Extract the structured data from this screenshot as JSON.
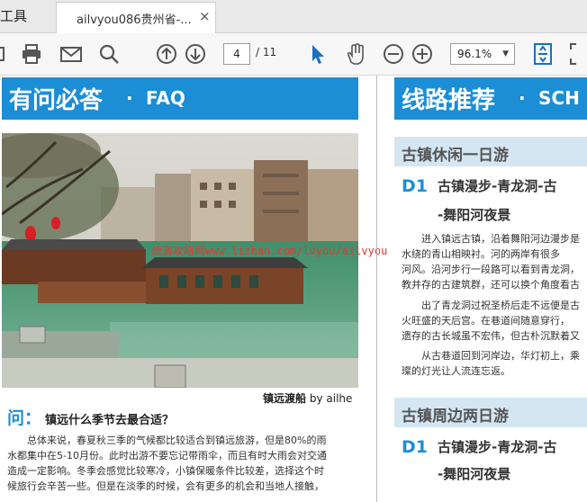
{
  "tabs": {
    "tools_label": "工具",
    "doc_label": "ailvyou086贵州省-...",
    "close_symbol": "×"
  },
  "toolbar": {
    "page_current": "4",
    "page_total": "/ 11",
    "zoom": "96.1%"
  },
  "left": {
    "banner_main": "有问必答",
    "banner_dot": "·",
    "banner_en": "FAQ",
    "watermark": "旅游攻略网www.lizhan.com/lvyou/ailvyou",
    "caption_title": "镇远渡船",
    "caption_by": "by ailhe",
    "q_mark": "问：",
    "question": "镇远什么季节去最合适？",
    "answer_lines": [
      "总体来说，春夏秋三季的气候都比较适合到镇远旅游，但是80%的雨",
      "水都集中在5-10月份。此时出游不要忘记带雨伞，而且有时大雨会对交通",
      "造成一定影响。冬季会感觉比较寒冷，小镇保暖条件比较差，选择这个时",
      "候旅行会辛苦一些。但是在淡季的时候，会有更多的机会和当地人接触，"
    ]
  },
  "right": {
    "banner_main": "线路推荐",
    "banner_dot": "·",
    "banner_en": "SCH",
    "sec1": "古镇休闲一日游",
    "d1_label": "D1",
    "d1_title_1": "古镇漫步-青龙洞-古",
    "d1_title_2": "-舞阳河夜景",
    "d1_lines": [
      "进入镇远古镇，沿着舞阳河边漫步是",
      "水绕的青山相映衬。河的两岸有很多",
      "河风。沿河步行一段路可以看到青龙洞，",
      "教并存的古建筑群，还可以换个角度看古",
      "出了青龙洞过祝圣桥后走不远便是古",
      "火旺盛的天后宫。在巷道间随意穿行，",
      "遗存的古长城虽不宏伟，但古朴沉默着又",
      "从古巷道回到河岸边，华灯初上，乘",
      "璨的灯光让人流连忘返。"
    ],
    "sec2": "古镇周边两日游",
    "d1b_label": "D1",
    "d1b_title_1": "古镇漫步-青龙洞-古",
    "d1b_title_2": "-舞阳河夜景"
  },
  "colors": {
    "accent": "#1b8ed6",
    "section_bg": "#d3e6f2",
    "watermark": "#e33333"
  },
  "icons": [
    "print-icon",
    "mail-icon",
    "search-icon",
    "page-up-icon",
    "page-down-icon",
    "select-cursor-icon",
    "hand-icon",
    "zoom-out-icon",
    "zoom-in-icon",
    "fit-page-icon",
    "expand-icon"
  ]
}
